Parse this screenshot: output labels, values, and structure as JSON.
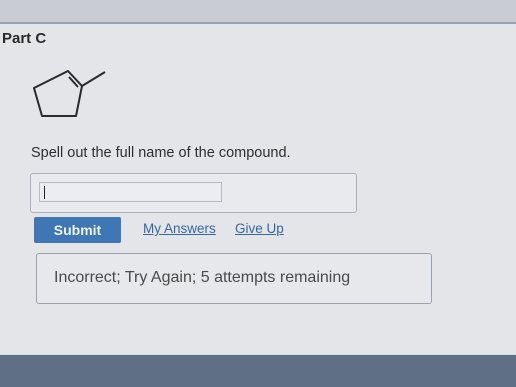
{
  "part": {
    "title": "Part C"
  },
  "question": {
    "prompt": "Spell out the full name of the compound."
  },
  "answer": {
    "value": "",
    "placeholder": ""
  },
  "actions": {
    "submit_label": "Submit",
    "my_answers_label": "My Answers",
    "give_up_label": "Give Up"
  },
  "feedback": {
    "message": "Incorrect; Try Again; 5 attempts remaining"
  },
  "colors": {
    "submit": "#3f76b4",
    "link": "#3766a4"
  }
}
